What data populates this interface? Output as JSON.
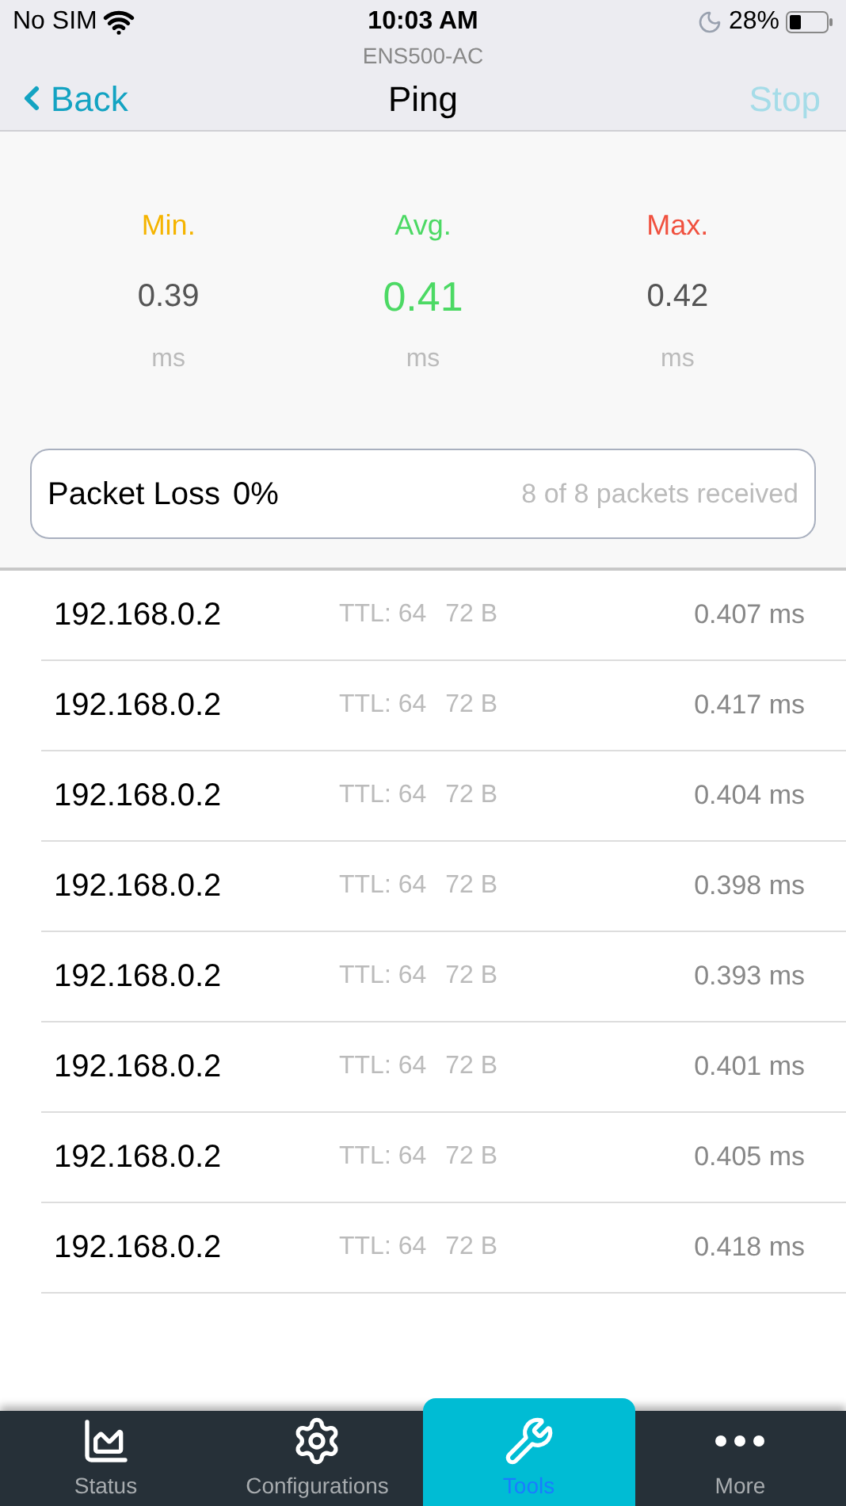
{
  "status_bar": {
    "carrier": "No SIM",
    "time": "10:03 AM",
    "battery": "28%"
  },
  "nav": {
    "subtitle": "ENS500-AC",
    "title": "Ping",
    "back": "Back",
    "action": "Stop",
    "action_disabled": true
  },
  "stats": [
    {
      "label": "Min.",
      "value": "0.39",
      "unit": "ms",
      "color": "#f5b400",
      "kind": "plain"
    },
    {
      "label": "Avg.",
      "value": "0.41",
      "unit": "ms",
      "color": "#4cd964",
      "kind": "primary"
    },
    {
      "label": "Max.",
      "value": "0.42",
      "unit": "ms",
      "color": "#f0513f",
      "kind": "plain"
    }
  ],
  "packet_loss": {
    "label": "Packet Loss",
    "value": "0%",
    "summary": "8 of 8 packets received"
  },
  "replies": [
    {
      "host": "192.168.0.2",
      "ttl": "TTL: 64",
      "size": "72 B",
      "time": "0.407 ms"
    },
    {
      "host": "192.168.0.2",
      "ttl": "TTL: 64",
      "size": "72 B",
      "time": "0.417 ms"
    },
    {
      "host": "192.168.0.2",
      "ttl": "TTL: 64",
      "size": "72 B",
      "time": "0.404 ms"
    },
    {
      "host": "192.168.0.2",
      "ttl": "TTL: 64",
      "size": "72 B",
      "time": "0.398 ms"
    },
    {
      "host": "192.168.0.2",
      "ttl": "TTL: 64",
      "size": "72 B",
      "time": "0.393 ms"
    },
    {
      "host": "192.168.0.2",
      "ttl": "TTL: 64",
      "size": "72 B",
      "time": "0.401 ms"
    },
    {
      "host": "192.168.0.2",
      "ttl": "TTL: 64",
      "size": "72 B",
      "time": "0.405 ms"
    },
    {
      "host": "192.168.0.2",
      "ttl": "TTL: 64",
      "size": "72 B",
      "time": "0.418 ms"
    }
  ],
  "tab_bar": [
    {
      "label": "Status",
      "kind": "chart",
      "selected": false
    },
    {
      "label": "Configurations",
      "kind": "gear",
      "selected": false
    },
    {
      "label": "Tools",
      "kind": "tools",
      "selected": true
    },
    {
      "label": "More",
      "kind": "more",
      "selected": false
    }
  ]
}
